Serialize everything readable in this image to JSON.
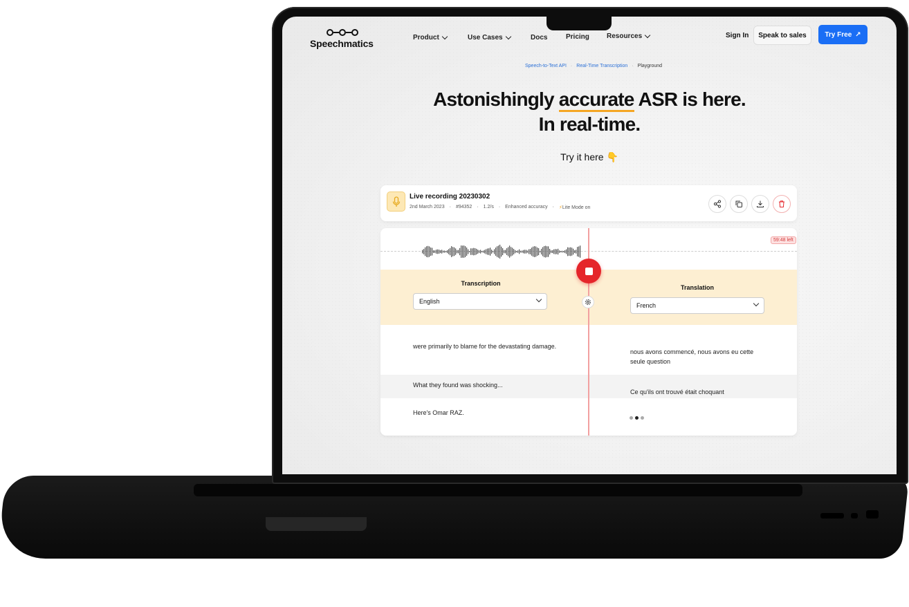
{
  "nav": {
    "logo_text": "Speechmatics",
    "items": [
      "Product",
      "Use Cases",
      "Docs",
      "Pricing",
      "Resources"
    ],
    "sign_in": "Sign In",
    "speak_to_sales": "Speak to sales",
    "try_free": "Try Free"
  },
  "breadcrumb": {
    "level1": "Speech-to-Text API",
    "level2": "Real-Time Transcription",
    "current": "Playground",
    "separator": "·"
  },
  "hero": {
    "line1_pre": "Astonishingly ",
    "line1_accent": "accurate",
    "line1_post": " ASR is here.",
    "line2": "In real-time.",
    "try_here": "Try it here 👇"
  },
  "recording": {
    "title": "Live recording 20230302",
    "date": "2nd March 2023",
    "id": "#94352",
    "speed": "1.2/s",
    "accuracy": "Enhanced accuracy",
    "mode": "Lite Mode on",
    "time_left": "59:48 left"
  },
  "transcription": {
    "title": "Transcription",
    "language": "English",
    "lines": [
      "were primarily to blame for the devastating damage.",
      "What they found was shocking...",
      "Here's Omar RAZ."
    ]
  },
  "translation": {
    "title": "Translation",
    "language": "French",
    "lines": [
      "nous avons commencé, nous avons eu cette seule question",
      "Ce qu'ils ont trouvé était choquant"
    ]
  },
  "colors": {
    "accent_blue": "#1a6ef5",
    "record_red": "#e5252a",
    "highlight": "#f5a623",
    "band": "#fdefd2"
  }
}
